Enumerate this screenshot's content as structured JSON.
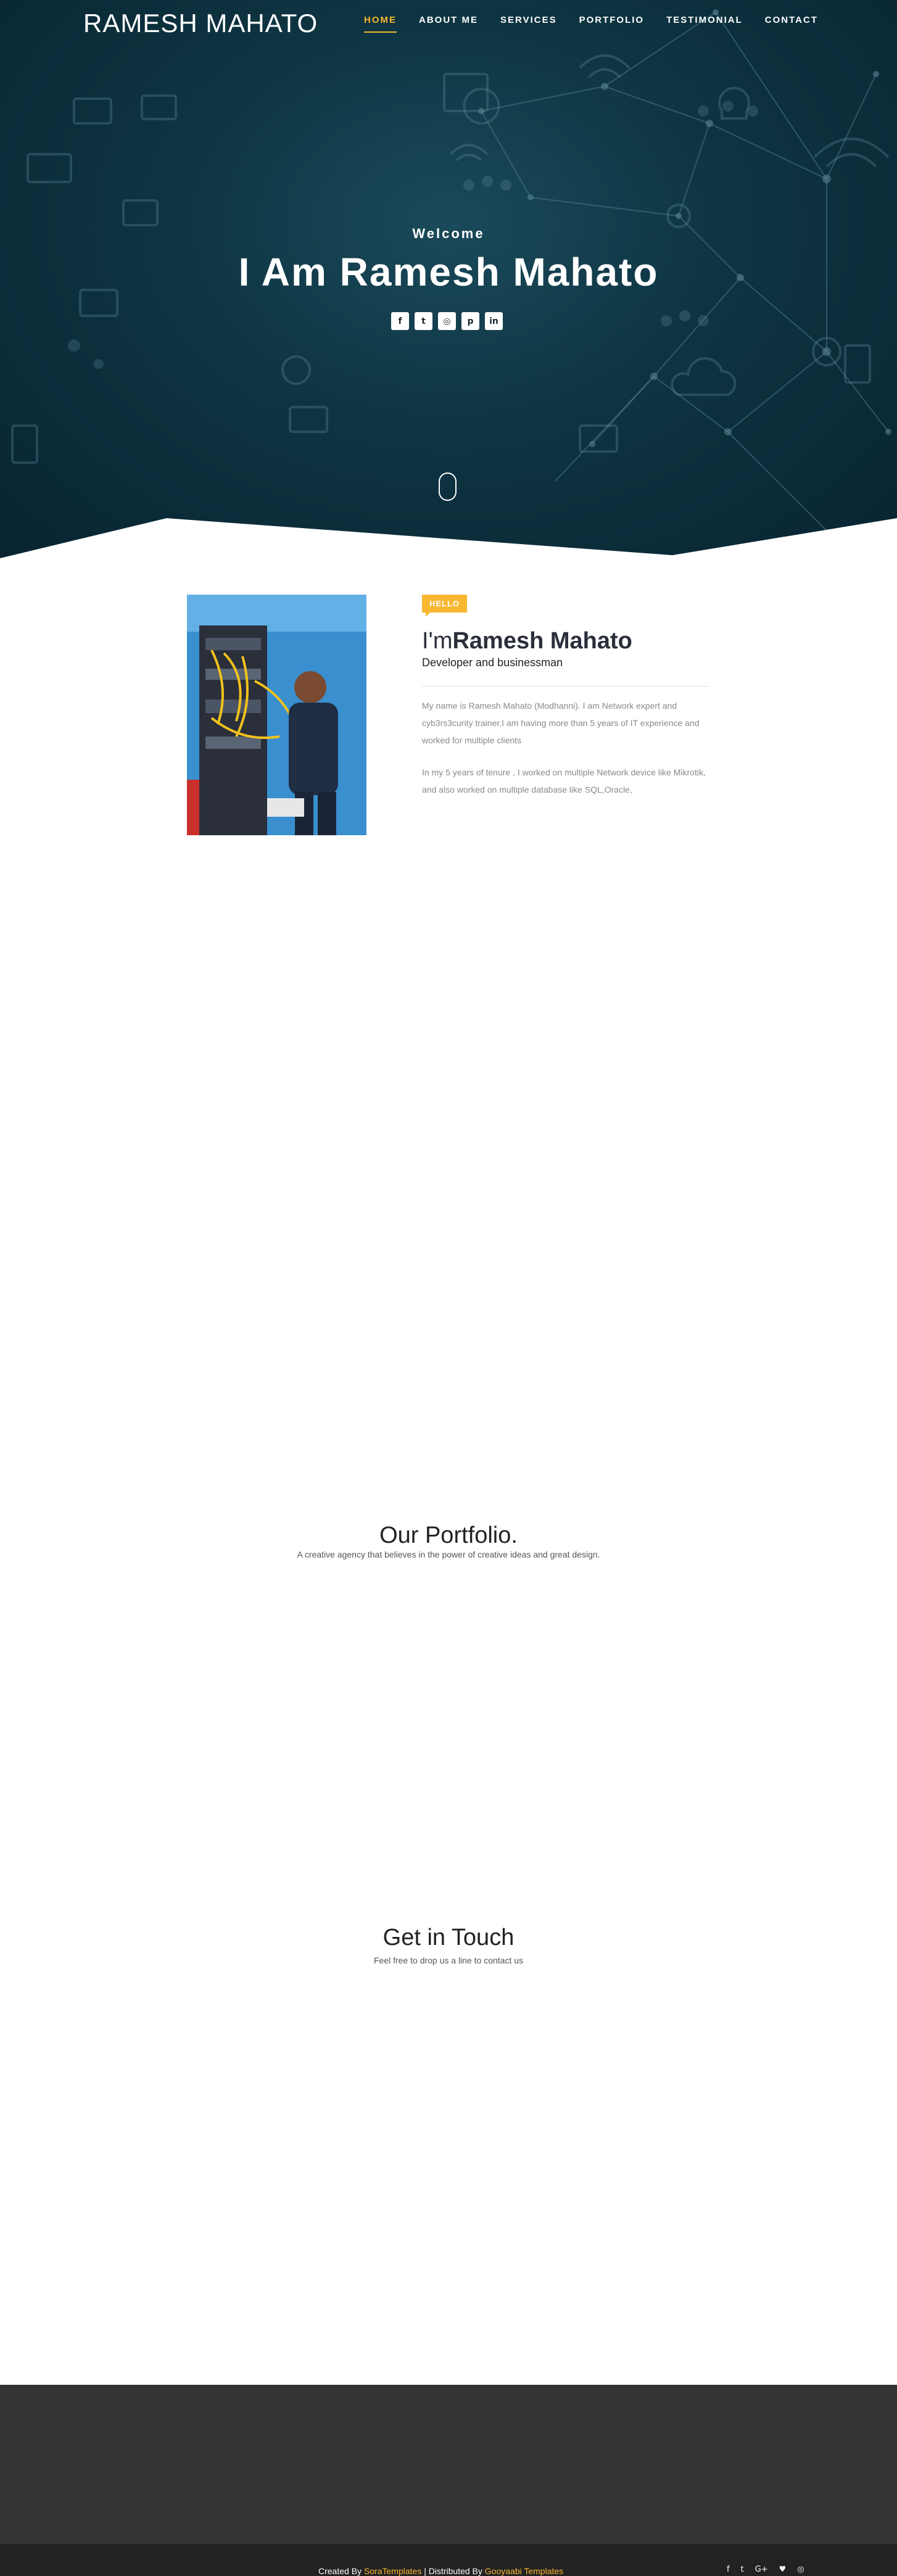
{
  "header": {
    "site_title": "RAMESH MAHATO",
    "nav": [
      {
        "label": "HOME",
        "active": true
      },
      {
        "label": "ABOUT ME",
        "active": false
      },
      {
        "label": "SERVICES",
        "active": false
      },
      {
        "label": "PORTFOLIO",
        "active": false
      },
      {
        "label": "TESTIMONIAL",
        "active": false
      },
      {
        "label": "CONTACT",
        "active": false
      }
    ]
  },
  "hero": {
    "welcome": "Welcome",
    "title": "I Am Ramesh Mahato",
    "social": [
      {
        "icon": "facebook-icon",
        "glyph": "f"
      },
      {
        "icon": "twitter-icon",
        "glyph": "t"
      },
      {
        "icon": "instagram-icon",
        "glyph": "◎"
      },
      {
        "icon": "pinterest-icon",
        "glyph": "p"
      },
      {
        "icon": "linkedin-icon",
        "glyph": "in"
      }
    ]
  },
  "about": {
    "badge": "HELLO",
    "name_prefix": "I'm",
    "name": "Ramesh Mahato",
    "role": "Developer and businessman",
    "paragraph1": "My name is Ramesh Mahato (Modhanni). I am Network expert and cyb3rs3curity trainer.I am having more than 5 years of IT experience and worked for multiple clients",
    "paragraph2": "In my 5 years of tenure , I worked on multiple Network device like Mikrotik, and also worked on multiple database like SQL,Oracle,"
  },
  "portfolio": {
    "title": "Our Portfolio.",
    "subtitle": "A creative agency that believes in the power of creative ideas and great design."
  },
  "contact": {
    "title": "Get in Touch",
    "subtitle": "Feel free to drop us a line to contact us"
  },
  "footer": {
    "created_by": "Created By ",
    "created_link": "SoraTemplates",
    "distributed_by": " | Distributed By ",
    "distributed_link": "Gooyaabi Templates",
    "social": [
      {
        "icon": "facebook-icon",
        "glyph": "f"
      },
      {
        "icon": "twitter-icon",
        "glyph": "t"
      },
      {
        "icon": "google-plus-icon",
        "glyph": "G+"
      },
      {
        "icon": "heart-icon",
        "glyph": "♥"
      },
      {
        "icon": "instagram-icon",
        "glyph": "◎"
      }
    ]
  },
  "colors": {
    "accent": "#f7b730",
    "hero_bg": "#0e3442",
    "footer_top": "#333333",
    "footer_bottom": "#222222"
  }
}
